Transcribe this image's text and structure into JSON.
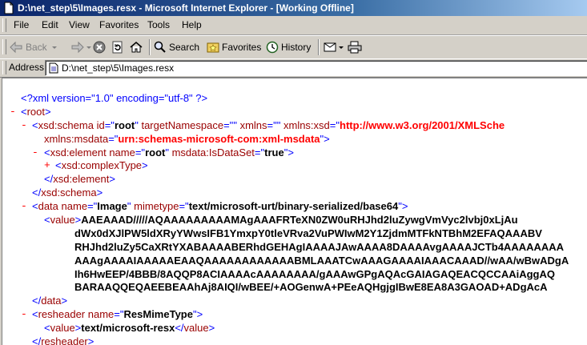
{
  "window": {
    "title": "D:\\net_step\\5\\Images.resx - Microsoft Internet Explorer - [Working Offline]"
  },
  "menu": {
    "items": [
      "File",
      "Edit",
      "View",
      "Favorites",
      "Tools",
      "Help"
    ]
  },
  "toolbar": {
    "back_label": "Back",
    "search_label": "Search",
    "favorites_label": "Favorites",
    "history_label": "History"
  },
  "address": {
    "label": "Address",
    "value": "D:\\net_step\\5\\Images.resx"
  },
  "xml": {
    "prolog": "<?xml version=\"1.0\" encoding=\"utf-8\" ?>",
    "root_open": "root",
    "schema": {
      "tag": "xsd:schema",
      "id_attr": "id",
      "id_val": "root",
      "tns_attr": "targetNamespace",
      "tns_val": "",
      "xmlns_attr": "xmlns",
      "xmlns_val": "",
      "xsd_attr": "xmlns:xsd",
      "xsd_val": "http://www.w3.org/2001/XMLSche",
      "msdata_attr": "xmlns:msdata",
      "msdata_val": "urn:schemas-microsoft-com:xml-msdata"
    },
    "element": {
      "tag": "xsd:element",
      "name_attr": "name",
      "name_val": "root",
      "ds_attr": "msdata:IsDataSet",
      "ds_val": "true"
    },
    "complex_type": "xsd:complexType",
    "element_close": "xsd:element",
    "schema_close": "xsd:schema",
    "data": {
      "tag": "data",
      "name_attr": "name",
      "name_val": "Image",
      "mime_attr": "mimetype",
      "mime_val": "text/microsoft-urt/binary-serialized/base64",
      "value_tag": "value",
      "lines": [
        "AAEAAAD/////AQAAAAAAAAAMAgAAAFRTeXN0ZW0uRHJhd2luZywgVmVyc2lvbj0xLjAu",
        "dWx0dXJlPW5ldXRyYWwsIFB1YmxpY0tleVRva2VuPWIwM2Y1ZjdmMTFkNTBhM2EFAQAAABV",
        "RHJhd2luZy5CaXRtYXABAAAABERhdGEHAgIAAAAJAwAAAA8DAAAAvgAAAAJCTb4AAAAAAAA",
        "AAAgAAAAIAAAAAEAAQAAAAAAAAAAAABMLAAATCwAAAGAAAAIAAACAAAD//wAA/wBwADgA",
        "Ih6HwEEP/4BBB/8AQQP8ACIAAAAcAAAAAAAA/gAAAwGPgAQAcGAIAGAQEACQCCAAiAggAQ",
        "BARAAQQEQAEEBEAAhAj8AIQI/wBEE/+AOGenwA+PEeAQHgjgIBwE8EA8A3GAOAD+ADgAcA"
      ],
      "close": "data"
    },
    "resheader": {
      "tag": "resheader",
      "name_attr": "name",
      "name_val": "ResMimeType",
      "value_tag": "value",
      "value_text": "text/microsoft-resx",
      "close": "resheader"
    }
  },
  "colors": {
    "title_start": "#0a246a",
    "title_end": "#a6caf0",
    "tag": "#990000",
    "punct": "#0000ff",
    "ns_value": "#ff0000"
  }
}
